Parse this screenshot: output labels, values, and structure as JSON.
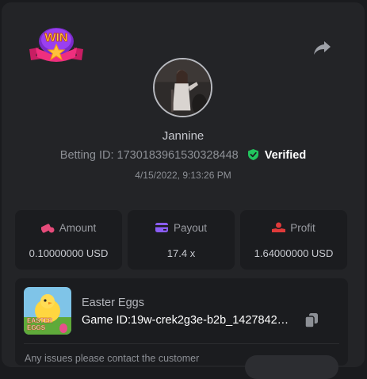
{
  "header": {
    "logo_text": "WIN",
    "share_icon": "share-icon"
  },
  "user": {
    "name": "Jannine",
    "betting_id_label": "Betting ID:",
    "betting_id": "1730183961530328448",
    "verified_label": "Verified",
    "timestamp": "4/15/2022, 9:13:26 PM"
  },
  "stats": {
    "amount": {
      "label": "Amount",
      "value": "0.10000000 USD",
      "icon": "coins-icon",
      "icon_color": "#e64b7a"
    },
    "payout": {
      "label": "Payout",
      "value": "17.4 x",
      "icon": "card-icon",
      "icon_color": "#8a5cf6"
    },
    "profit": {
      "label": "Profit",
      "value": "1.64000000 USD",
      "icon": "hand-coin-icon",
      "icon_color": "#e03a3a"
    }
  },
  "game": {
    "name": "Easter Eggs",
    "thumb_title": "EASTER EGGS",
    "id_label": "Game ID:",
    "id": "19w-crek2g3e-b2b_1427842…",
    "issue_text": "Any issues please contact the customer"
  },
  "colors": {
    "verified": "#22c55e",
    "background": "#232427",
    "card": "#1b1c1f"
  }
}
